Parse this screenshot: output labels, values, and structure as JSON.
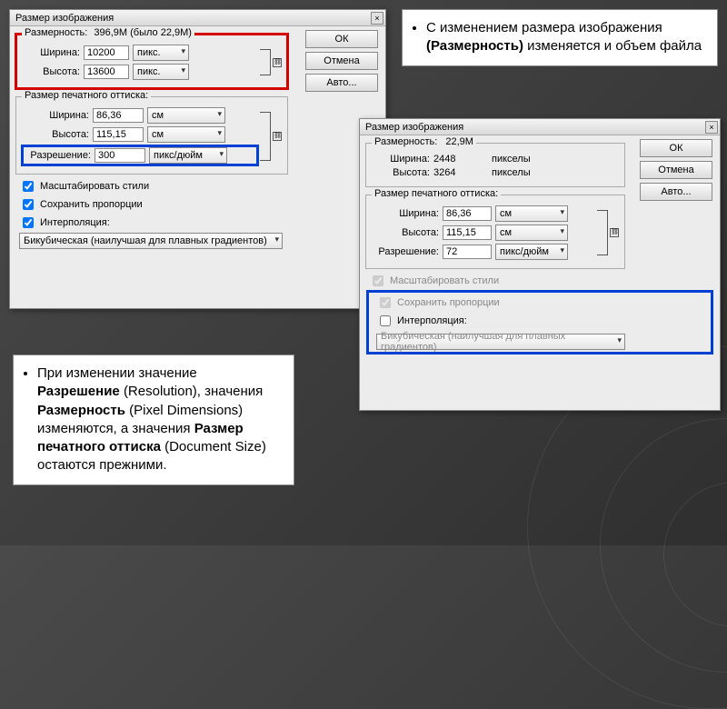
{
  "slide": {
    "note_right": {
      "prefix": "С изменением размера изображения ",
      "bold": "(Размерность)",
      "suffix": " изменяется и объем файла"
    },
    "note_left": {
      "p1": "При изменении значение ",
      "b1": "Разрешение",
      "p2": " (Resolution), значения ",
      "b2": "Размерность",
      "p3": " (Pixel Dimensions) изменяются, а значения ",
      "b3": "Размер печатного оттиска",
      "p4": " (Document Size) остаются прежними."
    }
  },
  "dialog1": {
    "title": "Размер изображения",
    "dim_label": "Размерность:",
    "dim_value": "396,9М (было 22,9М)",
    "width_label": "Ширина:",
    "width_value": "10200",
    "height_label": "Высота:",
    "height_value": "13600",
    "unit_px": "пикс.",
    "print_legend": "Размер печатного оттиска:",
    "pwidth": "86,36",
    "pheight": "115,15",
    "unit_cm": "см",
    "res_label": "Разрешение:",
    "res_value": "300",
    "unit_res": "пикс/дюйм",
    "chk_scale": "Масштабировать стили",
    "chk_prop": "Сохранить пропорции",
    "chk_interp": "Интерполяция:",
    "interp_method": "Бикубическая (наилучшая для плавных градиентов)",
    "btn_ok": "ОК",
    "btn_cancel": "Отмена",
    "btn_auto": "Авто..."
  },
  "dialog2": {
    "title": "Размер изображения",
    "dim_label": "Размерность:",
    "dim_value": "22,9М",
    "width_label": "Ширина:",
    "width_value": "2448",
    "height_label": "Высота:",
    "height_value": "3264",
    "unit_px_full": "пикселы",
    "print_legend": "Размер печатного оттиска:",
    "pwidth": "86,36",
    "pheight": "115,15",
    "unit_cm": "см",
    "res_label": "Разрешение:",
    "res_value": "72",
    "unit_res": "пикс/дюйм",
    "chk_scale": "Масштабировать стили",
    "chk_prop": "Сохранить пропорции",
    "chk_interp": "Интерполяция:",
    "interp_method": "Бикубическая (наилучшая для плавных градиентов)",
    "btn_ok": "ОК",
    "btn_cancel": "Отмена",
    "btn_auto": "Авто..."
  }
}
